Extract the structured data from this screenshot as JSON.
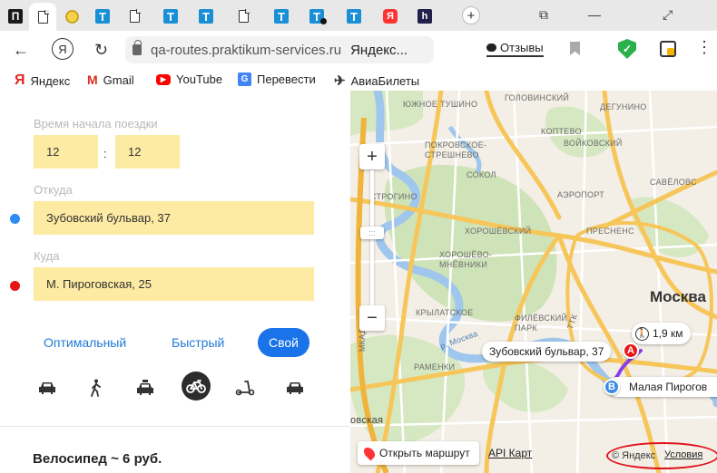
{
  "browser": {
    "tabs": [
      {
        "icon": "pocket-icon",
        "glyph": "П"
      },
      {
        "icon": "document-icon",
        "glyph": ""
      },
      {
        "icon": "coin-icon",
        "glyph": ""
      },
      {
        "icon": "t-icon",
        "glyph": "T"
      },
      {
        "icon": "document-icon",
        "glyph": ""
      },
      {
        "icon": "t-icon",
        "glyph": "T"
      },
      {
        "icon": "t-icon",
        "glyph": "T"
      },
      {
        "icon": "document-icon",
        "glyph": ""
      },
      {
        "icon": "t-icon",
        "glyph": "T"
      },
      {
        "icon": "t-icon",
        "glyph": "T"
      },
      {
        "icon": "t-icon",
        "glyph": "T"
      },
      {
        "icon": "yandex-icon",
        "glyph": "Я"
      },
      {
        "icon": "hh-icon",
        "glyph": "h"
      }
    ],
    "new_tab": "+",
    "window_controls": {
      "restore": "⧉",
      "minimize": "—",
      "maximize": "⤢"
    },
    "back": "←",
    "yandex_button": "Я",
    "reload": "↻",
    "url": "qa-routes.praktikum-services.ru",
    "page_title": "Яндекс...",
    "reviews": "Отзывы",
    "more": "⋮",
    "bookmarks": [
      {
        "icon": "yandex-bookmark-icon",
        "glyph": "Я",
        "color": "#e52620",
        "label": "Яндекс"
      },
      {
        "icon": "gmail-icon",
        "glyph": "M",
        "color": "#d93025",
        "label": "Gmail"
      },
      {
        "icon": "youtube-icon",
        "glyph": "▶",
        "color": "#ff0000",
        "label": "YouTube"
      },
      {
        "icon": "translate-icon",
        "glyph": "G",
        "color": "#4285f4",
        "label": "Перевести"
      },
      {
        "icon": "plane-icon",
        "glyph": "✈",
        "color": "#333333",
        "label": "АвиаБилеты"
      }
    ]
  },
  "form": {
    "time_label": "Время начала поездки",
    "hour": "12",
    "separator": ":",
    "minute": "12",
    "from_label": "Откуда",
    "from_value": "Зубовский бульвар, 37",
    "to_label": "Куда",
    "to_value": "М. Пироговская, 25",
    "modes": {
      "optimal": "Оптимальный",
      "fast": "Быстрый",
      "custom": "Свой"
    },
    "transports": [
      "car-icon",
      "walk-icon",
      "taxi-icon",
      "bicycle-icon",
      "scooter-icon",
      "drive-icon"
    ],
    "price": "Велосипед ~ 6 руб."
  },
  "map": {
    "zoom_in": "+",
    "zoom_out": "−",
    "zoom_handle": ":::",
    "city": "Москва",
    "distance": "1,9 км",
    "point_a": {
      "letter": "A",
      "label": "Зубовский бульвар, 37"
    },
    "point_b": {
      "letter": "B",
      "label": "Малая Пирогов"
    },
    "open_route": "Открыть маршрут",
    "api": "API Карт",
    "copyright": "© Яндекс",
    "terms": "Условия",
    "labels": [
      "ГОЛОВИНСКИЙ",
      "ДЕГУНИНО",
      "ЮЖНОЕ ТУШИНО",
      "КОПТЕВО",
      "ПОКРОВСКОЕ-",
      "СТРЕШНЕВО",
      "ВОЙКОВСКИЙ",
      "СОКОЛ",
      "САВЁЛОВС",
      "АЭРОПОРТ",
      "СТРОГИНО",
      "ХОРОШЁВСКИЙ",
      "ПРЕСНЕНС",
      "ХОРОШЁВО-",
      "МНЁВНИКИ",
      "КРЫЛАТСКОЕ",
      "ФИЛЁВСКИЙ",
      "ПАРК",
      "р. Москва",
      "ТТК",
      "МКАД",
      "овская",
      "РАМЕНКИ"
    ],
    "colors": {
      "land": "#f3efe6",
      "park": "#cfe3b8",
      "water": "#9fc6ec",
      "road_major": "#f7c65a",
      "road_minor": "#ffffff",
      "route": "#8a3fe6"
    }
  }
}
